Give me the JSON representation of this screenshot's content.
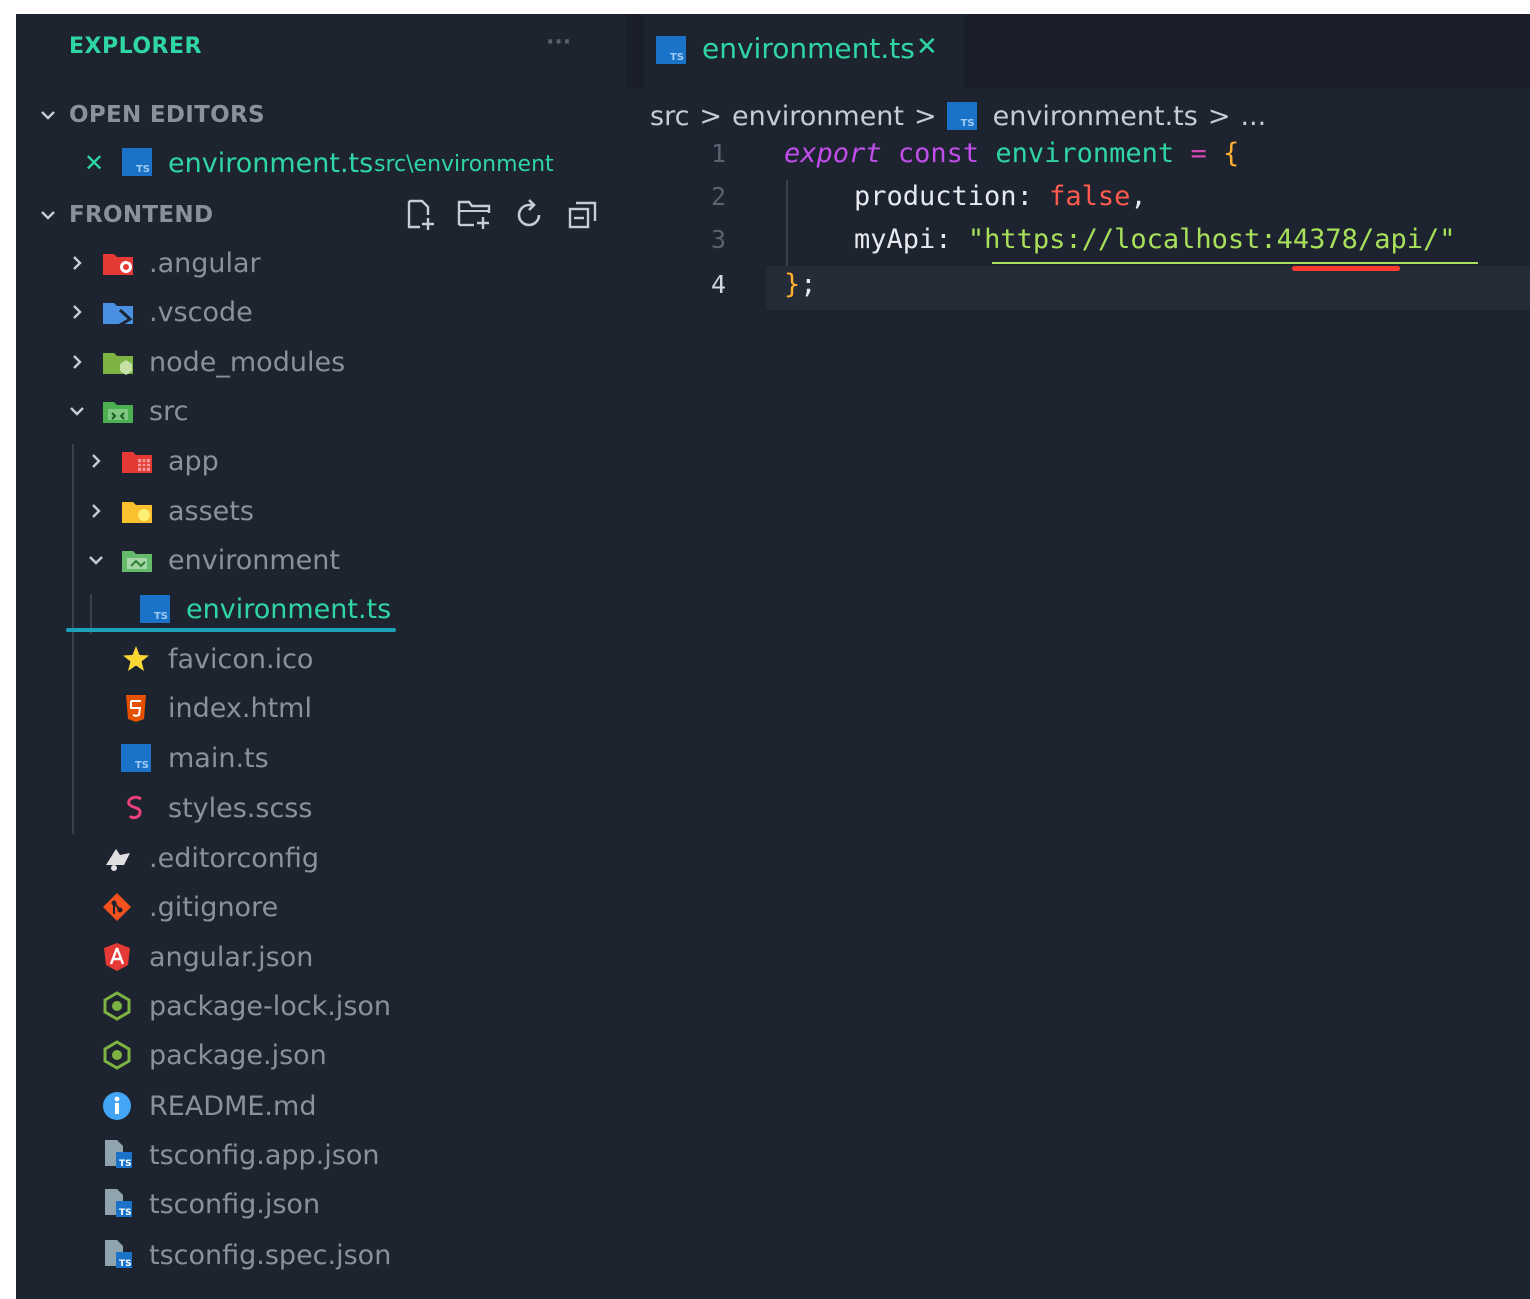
{
  "explorer": {
    "title": "EXPLORER",
    "more": "···",
    "open_editors": {
      "header": "OPEN EDITORS",
      "items": [
        {
          "close": "✕",
          "name": "environment.ts",
          "path": "src\\environment"
        }
      ]
    },
    "project": {
      "header": "FRONTEND",
      "actions": [
        "new-file-icon",
        "new-folder-icon",
        "refresh-icon",
        "collapse-all-icon"
      ],
      "tree": [
        {
          "name": ".angular",
          "type": "folder",
          "icon": "angular-folder-icon"
        },
        {
          "name": ".vscode",
          "type": "folder",
          "icon": "vscode-folder-icon"
        },
        {
          "name": "node_modules",
          "type": "folder",
          "icon": "node-folder-icon"
        },
        {
          "name": "src",
          "type": "folder",
          "icon": "src-folder-icon"
        },
        {
          "name": "app",
          "type": "folder",
          "icon": "app-folder-icon"
        },
        {
          "name": "assets",
          "type": "folder",
          "icon": "assets-folder-icon"
        },
        {
          "name": "environment",
          "type": "folder",
          "icon": "environment-folder-icon"
        },
        {
          "name": "environment.ts",
          "type": "file",
          "icon": "typescript-icon"
        },
        {
          "name": "favicon.ico",
          "type": "file",
          "icon": "star-icon"
        },
        {
          "name": "index.html",
          "type": "file",
          "icon": "html5-icon"
        },
        {
          "name": "main.ts",
          "type": "file",
          "icon": "typescript-icon"
        },
        {
          "name": "styles.scss",
          "type": "file",
          "icon": "sass-icon"
        },
        {
          "name": ".editorconfig",
          "type": "file",
          "icon": "editorconfig-icon"
        },
        {
          "name": ".gitignore",
          "type": "file",
          "icon": "git-icon"
        },
        {
          "name": "angular.json",
          "type": "file",
          "icon": "angular-icon"
        },
        {
          "name": "package-lock.json",
          "type": "file",
          "icon": "nodejs-icon"
        },
        {
          "name": "package.json",
          "type": "file",
          "icon": "nodejs-icon"
        },
        {
          "name": "README.md",
          "type": "file",
          "icon": "info-icon"
        },
        {
          "name": "tsconfig.app.json",
          "type": "file",
          "icon": "tsconfig-icon"
        },
        {
          "name": "tsconfig.json",
          "type": "file",
          "icon": "tsconfig-icon"
        },
        {
          "name": "tsconfig.spec.json",
          "type": "file",
          "icon": "tsconfig-icon"
        }
      ]
    }
  },
  "editor": {
    "tab": {
      "label": "environment.ts",
      "close": "✕"
    },
    "breadcrumb": {
      "seg1": "src",
      "seg2": "environment",
      "seg3": "environment.ts",
      "sep": ">",
      "more": "..."
    },
    "line_numbers": [
      "1",
      "2",
      "3",
      "4"
    ],
    "code": {
      "l1_export": "export",
      "l1_const": "const",
      "l1_name": "environment",
      "l1_eq": "=",
      "l1_brace": "{",
      "l2_key": "production",
      "l2_colon": ":",
      "l2_val": "false",
      "l2_comma": ",",
      "l3_key": "myApi",
      "l3_colon": ":",
      "l3_val": "\"https://localhost:44378/api/\"",
      "l4_brace": "}",
      "l4_semi": ";"
    }
  },
  "colors": {
    "background": "#1e2330",
    "accent_teal": "#2fd6a4",
    "keyword_purple": "#c04ee8",
    "string_green": "#a8e05a",
    "literal_red": "#ff5a4e",
    "punct_orange": "#ffb02e"
  }
}
